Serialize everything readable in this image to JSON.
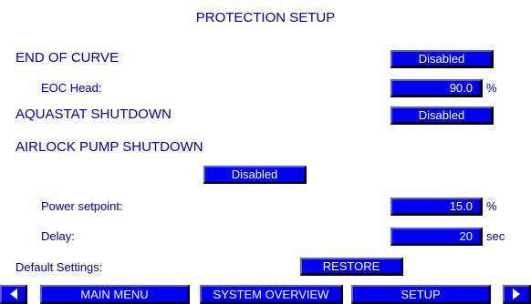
{
  "title": "PROTECTION SETUP",
  "end_of_curve": {
    "label": "END OF CURVE",
    "state": "Disabled",
    "eoc_head_label": "EOC Head:",
    "eoc_head_value": "90.0",
    "eoc_head_unit": "%"
  },
  "aquastat": {
    "label": "AQUASTAT SHUTDOWN",
    "state": "Disabled"
  },
  "airlock": {
    "label": "AIRLOCK PUMP SHUTDOWN",
    "state": "Disabled",
    "power_label": "Power setpoint:",
    "power_value": "15.0",
    "power_unit": "%",
    "delay_label": "Delay:",
    "delay_value": "20",
    "delay_unit": "sec"
  },
  "defaults": {
    "label": "Default Settings:",
    "restore_label": "RESTORE"
  },
  "nav": {
    "main_menu": "MAIN MENU",
    "system_overview": "SYSTEM OVERVIEW",
    "setup": "SETUP",
    "prev_icon": "arrow-left-icon",
    "next_icon": "arrow-right-icon"
  },
  "colors": {
    "text": "#0000a0",
    "button": "#0000f0",
    "button_text": "#ffffff"
  }
}
